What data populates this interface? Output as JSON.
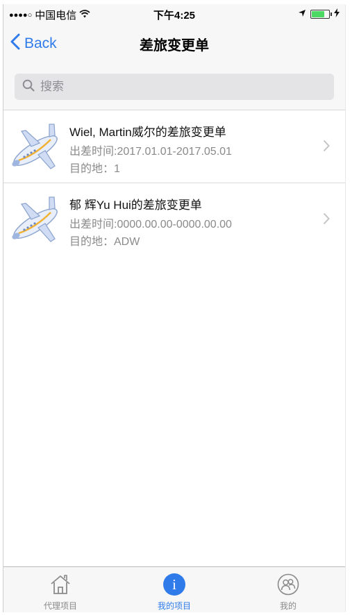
{
  "status_bar": {
    "signal": "●●●●○",
    "carrier": "中国电信",
    "time": "下午4:25",
    "battery_level": 0.75,
    "icons": [
      "wifi-icon",
      "location-arrow-icon",
      "battery-icon",
      "charging-bolt-icon"
    ]
  },
  "nav": {
    "back_label": "Back",
    "title": "差旅变更单"
  },
  "search": {
    "placeholder": "搜索",
    "value": ""
  },
  "list": {
    "items": [
      {
        "title": "Wiel, Martin威尔的差旅变更单",
        "time": "出差时间:2017.01.01-2017.05.01",
        "destination": "目的地：1",
        "icon": "airplane-icon"
      },
      {
        "title": "郁 辉Yu Hui的差旅变更单",
        "time": "出差时间:0000.00.00-0000.00.00",
        "destination": "目的地：ADW",
        "icon": "airplane-icon"
      }
    ]
  },
  "tabbar": {
    "tabs": [
      {
        "label": "代理项目",
        "icon": "home-icon",
        "active": false
      },
      {
        "label": "我的项目",
        "icon": "info-icon",
        "active": true
      },
      {
        "label": "我的",
        "icon": "user-group-icon",
        "active": false
      }
    ]
  },
  "colors": {
    "accent": "#2f7bea",
    "secondary_text": "#8a8a8a",
    "search_bg": "#e4e4e6",
    "battery_green": "#4cd964"
  }
}
